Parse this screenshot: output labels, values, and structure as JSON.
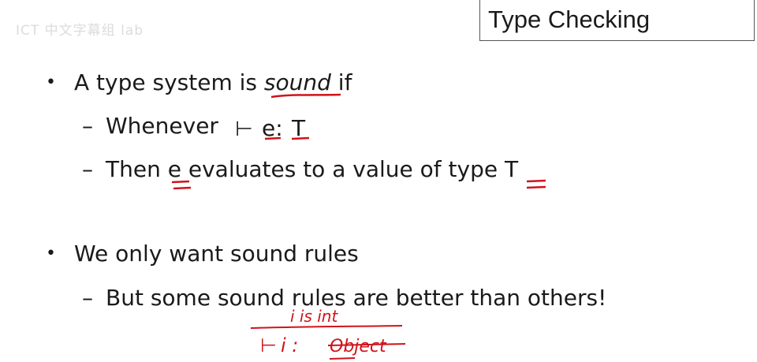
{
  "watermark": "ICT 中文字幕组 lab",
  "slide": {
    "title": "Type Checking",
    "bullet1": {
      "text_before": "A type system is ",
      "emph": "sound",
      "text_after": " if"
    },
    "sub1": {
      "prefix": "Whenever",
      "turnstile": "⊢",
      "expr": "e:",
      "type": "T"
    },
    "sub2": {
      "prefix": "Then ",
      "expr": "e",
      "middle": " evaluates to a value of type ",
      "type": "T"
    },
    "bullet2": {
      "text": "We only want sound rules"
    },
    "sub3": {
      "text": "But  some sound rules are better than others!"
    }
  },
  "annotations": {
    "ink_color": "#d0131b",
    "rule_premise": "i is int",
    "rule_conclusion_turnstile": "⊢",
    "rule_conclusion_expr": "i :",
    "rule_conclusion_type": "Object"
  }
}
